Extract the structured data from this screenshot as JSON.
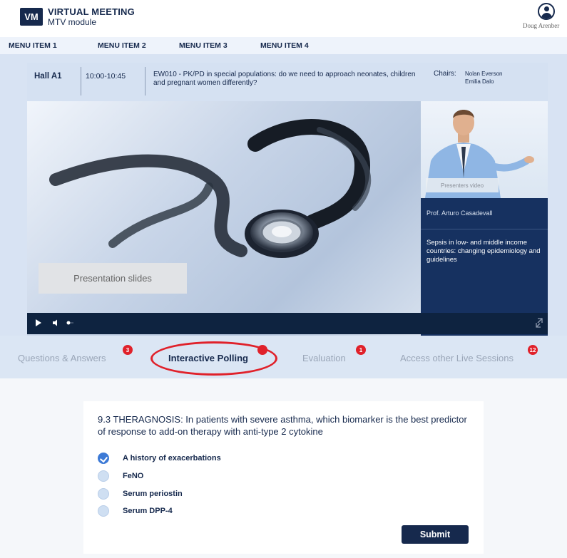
{
  "app": {
    "logo": "VM",
    "title": "VIRTUAL MEETING",
    "subtitle": "MTV module",
    "user_name": "Doug Arenber"
  },
  "menu": {
    "items": [
      "MENU ITEM 1",
      "MENU ITEM 2",
      "MENU ITEM 3",
      "MENU ITEM 4"
    ]
  },
  "session": {
    "hall": "Hall A1",
    "time": "10:00-10:45",
    "title": "EW010 - PK/PD in special populations: do we need to approach neonates, children and pregnant women differently?",
    "chairs_label": "Chairs:",
    "chairs": [
      "Nolan Everson",
      "Emilia Dalo"
    ]
  },
  "stage": {
    "slides_label": "Presentation slides",
    "presenter_video_label": "Presenters video",
    "speaker_name": "Prof. Arturo Casadevall",
    "talk_title": "Sepsis in low- and middle income countries: changing epidemiology and guidelines"
  },
  "tabs": [
    {
      "label": "Questions & Answers",
      "badge": "3",
      "active": false
    },
    {
      "label": "Interactive Polling",
      "badge": "",
      "active": true
    },
    {
      "label": "Evaluation",
      "badge": "1",
      "active": false
    },
    {
      "label": "Access other Live Sessions",
      "badge": "12",
      "active": false
    }
  ],
  "poll": {
    "question": "9.3 THERAGNOSIS: In patients with severe asthma, which biomarker is the best predictor of response to add-on therapy with anti-type 2 cytokine",
    "options": [
      {
        "label": "A history of exacerbations",
        "selected": true
      },
      {
        "label": "FeNO",
        "selected": false
      },
      {
        "label": "Serum periostin",
        "selected": false
      },
      {
        "label": "Serum DPP-4",
        "selected": false
      }
    ],
    "submit_label": "Submit"
  },
  "colors": {
    "navy": "#16294d",
    "badge_red": "#e0212a",
    "highlight_red": "#e0212a",
    "radio_checked": "#3d7ad6"
  }
}
